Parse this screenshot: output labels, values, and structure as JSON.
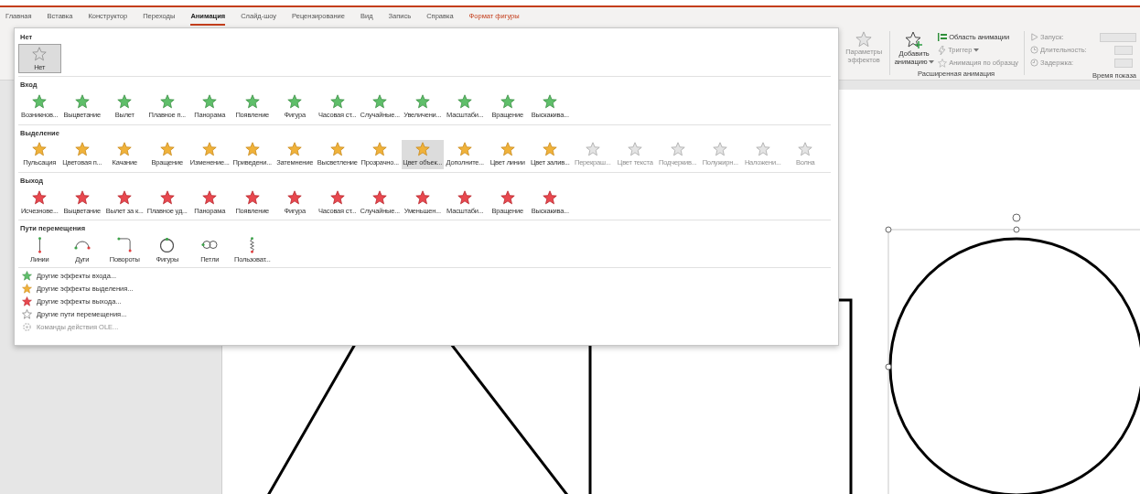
{
  "tabs": [
    {
      "label": "Главная",
      "selected": false,
      "kind": "standard"
    },
    {
      "label": "Вставка",
      "selected": false,
      "kind": "standard"
    },
    {
      "label": "Конструктор",
      "selected": false,
      "kind": "standard"
    },
    {
      "label": "Переходы",
      "selected": false,
      "kind": "standard"
    },
    {
      "label": "Анимация",
      "selected": true,
      "kind": "standard"
    },
    {
      "label": "Слайд-шоу",
      "selected": false,
      "kind": "standard"
    },
    {
      "label": "Рецензирование",
      "selected": false,
      "kind": "standard"
    },
    {
      "label": "Вид",
      "selected": false,
      "kind": "standard"
    },
    {
      "label": "Запись",
      "selected": false,
      "kind": "standard"
    },
    {
      "label": "Справка",
      "selected": false,
      "kind": "standard"
    },
    {
      "label": "Формат фигуры",
      "selected": false,
      "kind": "contextual"
    }
  ],
  "ribbon": {
    "effect_options": {
      "lines": [
        "Параметры",
        "эффектов"
      ],
      "disabled": true
    },
    "add_animation": {
      "lines": [
        "Добавить",
        "анимацию"
      ]
    },
    "advanced": [
      {
        "label": "Область анимации",
        "kind": "pane",
        "disabled": false
      },
      {
        "label": "Триггер",
        "kind": "trigger",
        "disabled": true
      },
      {
        "label": "Анимация по образцу",
        "kind": "painter",
        "disabled": true
      }
    ],
    "advanced_group": "Расширенная анимация",
    "timing": [
      {
        "label": "Запуск:",
        "kind": "start",
        "disabled": true
      },
      {
        "label": "Длительность:",
        "kind": "duration",
        "disabled": true
      },
      {
        "label": "Задержка:",
        "kind": "delay",
        "disabled": true
      }
    ],
    "timing_group": "Время показа"
  },
  "gallery": {
    "sections": [
      {
        "title": "Нет",
        "kind": "none",
        "items": [
          {
            "label": "Нет",
            "selected": true,
            "disabled": false
          }
        ]
      },
      {
        "title": "Вход",
        "kind": "entrance",
        "items": [
          {
            "label": "Возникнов...",
            "selected": false,
            "disabled": false
          },
          {
            "label": "Выцветание",
            "selected": false,
            "disabled": false
          },
          {
            "label": "Вылет",
            "selected": false,
            "disabled": false
          },
          {
            "label": "Плавное п...",
            "selected": false,
            "disabled": false
          },
          {
            "label": "Панорама",
            "selected": false,
            "disabled": false
          },
          {
            "label": "Появление",
            "selected": false,
            "disabled": false
          },
          {
            "label": "Фигура",
            "selected": false,
            "disabled": false
          },
          {
            "label": "Часовая ст...",
            "selected": false,
            "disabled": false
          },
          {
            "label": "Случайные...",
            "selected": false,
            "disabled": false
          },
          {
            "label": "Увеличени...",
            "selected": false,
            "disabled": false
          },
          {
            "label": "Масштаби...",
            "selected": false,
            "disabled": false
          },
          {
            "label": "Вращение",
            "selected": false,
            "disabled": false
          },
          {
            "label": "Выскакива...",
            "selected": false,
            "disabled": false
          }
        ]
      },
      {
        "title": "Выделение",
        "kind": "emphasis",
        "items": [
          {
            "label": "Пульсация",
            "selected": false,
            "disabled": false
          },
          {
            "label": "Цветовая п...",
            "selected": false,
            "disabled": false
          },
          {
            "label": "Качание",
            "selected": false,
            "disabled": false
          },
          {
            "label": "Вращение",
            "selected": false,
            "disabled": false
          },
          {
            "label": "Изменение...",
            "selected": false,
            "disabled": false
          },
          {
            "label": "Приведени...",
            "selected": false,
            "disabled": false
          },
          {
            "label": "Затемнение",
            "selected": false,
            "disabled": false
          },
          {
            "label": "Высветление",
            "selected": false,
            "disabled": false
          },
          {
            "label": "Прозрачно...",
            "selected": false,
            "disabled": false
          },
          {
            "label": "Цвет объек...",
            "selected": true,
            "disabled": false
          },
          {
            "label": "Дополните...",
            "selected": false,
            "disabled": false
          },
          {
            "label": "Цвет линии",
            "selected": false,
            "disabled": false
          },
          {
            "label": "Цвет залив...",
            "selected": false,
            "disabled": false
          },
          {
            "label": "Перекраш...",
            "selected": false,
            "disabled": true
          },
          {
            "label": "Цвет текста",
            "selected": false,
            "disabled": true
          },
          {
            "label": "Подчеркив...",
            "selected": false,
            "disabled": true
          },
          {
            "label": "Полужирн...",
            "selected": false,
            "disabled": true
          },
          {
            "label": "Наложени...",
            "selected": false,
            "disabled": true
          },
          {
            "label": "Волна",
            "selected": false,
            "disabled": true
          }
        ]
      },
      {
        "title": "Выход",
        "kind": "exit",
        "items": [
          {
            "label": "Исчезнове...",
            "selected": false,
            "disabled": false
          },
          {
            "label": "Выцветание",
            "selected": false,
            "disabled": false
          },
          {
            "label": "Вылет за к...",
            "selected": false,
            "disabled": false
          },
          {
            "label": "Плавное уд...",
            "selected": false,
            "disabled": false
          },
          {
            "label": "Панорама",
            "selected": false,
            "disabled": false
          },
          {
            "label": "Появление",
            "selected": false,
            "disabled": false
          },
          {
            "label": "Фигура",
            "selected": false,
            "disabled": false
          },
          {
            "label": "Часовая ст...",
            "selected": false,
            "disabled": false
          },
          {
            "label": "Случайные...",
            "selected": false,
            "disabled": false
          },
          {
            "label": "Уменьшен...",
            "selected": false,
            "disabled": false
          },
          {
            "label": "Масштаби...",
            "selected": false,
            "disabled": false
          },
          {
            "label": "Вращение",
            "selected": false,
            "disabled": false
          },
          {
            "label": "Выскакива...",
            "selected": false,
            "disabled": false
          }
        ]
      },
      {
        "title": "Пути перемещения",
        "kind": "path",
        "items": [
          {
            "label": "Линии",
            "kind": "line",
            "selected": false,
            "disabled": false
          },
          {
            "label": "Дуги",
            "kind": "arc",
            "selected": false,
            "disabled": false
          },
          {
            "label": "Повороты",
            "kind": "turn",
            "selected": false,
            "disabled": false
          },
          {
            "label": "Фигуры",
            "kind": "shape",
            "selected": false,
            "disabled": false
          },
          {
            "label": "Петли",
            "kind": "loop",
            "selected": false,
            "disabled": false
          },
          {
            "label": "Пользоват...",
            "kind": "custom",
            "selected": false,
            "disabled": false
          }
        ]
      }
    ],
    "more": [
      {
        "label": "Другие эффекты входа...",
        "kind": "entrance",
        "disabled": false
      },
      {
        "label": "Другие эффекты выделения...",
        "kind": "emphasis",
        "disabled": false
      },
      {
        "label": "Другие эффекты выхода...",
        "kind": "exit",
        "disabled": false
      },
      {
        "label": "Другие пути перемещения...",
        "kind": "path",
        "disabled": false
      },
      {
        "label": "Команды действия OLE...",
        "kind": "ole",
        "disabled": true
      }
    ]
  }
}
